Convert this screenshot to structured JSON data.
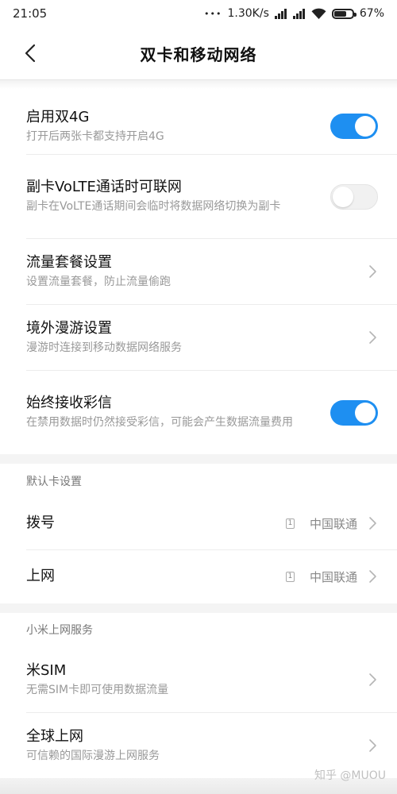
{
  "status_bar": {
    "time": "21:05",
    "dots": "•••",
    "speed": "1.30K/s",
    "battery": "67%",
    "battery_level": 0.67,
    "icons": [
      "signal-icon",
      "signal-icon",
      "wifi-icon",
      "battery-icon"
    ]
  },
  "nav": {
    "title": "双卡和移动网络",
    "back_icon": "back-arrow-icon"
  },
  "items": [
    {
      "title": "启用双4G",
      "subtitle": "打开后两张卡都支持开启4G",
      "toggle": "on"
    },
    {
      "title": "副卡VoLTE通话时可联网",
      "subtitle": "副卡在VoLTE通话期间会临时将数据网络切换为副卡",
      "toggle": "off"
    },
    {
      "title": "流量套餐设置",
      "subtitle": "设置流量套餐，防止流量偷跑",
      "control": "chevron"
    },
    {
      "title": "境外漫游设置",
      "subtitle": "漫游时连接到移动数据网络服务",
      "control": "chevron"
    },
    {
      "title": "始终接收彩信",
      "subtitle": "在禁用数据时仍然接受彩信，可能会产生数据流量费用",
      "toggle": "on"
    }
  ],
  "default_card": {
    "header": "默认卡设置",
    "items": [
      {
        "title": "拨号",
        "sim": "1",
        "value": "中国联通"
      },
      {
        "title": "上网",
        "sim": "1",
        "value": "中国联通"
      }
    ]
  },
  "mi_service": {
    "header": "小米上网服务",
    "items": [
      {
        "title": "米SIM",
        "subtitle": "无需SIM卡即可使用数据流量"
      },
      {
        "title": "全球上网",
        "subtitle": "可信赖的国际漫游上网服务"
      }
    ]
  },
  "watermark": "知乎 @MUOU",
  "colors": {
    "accent": "#1e8ff1",
    "subtitle": "#999999",
    "section_bg": "#f4f4f4"
  }
}
